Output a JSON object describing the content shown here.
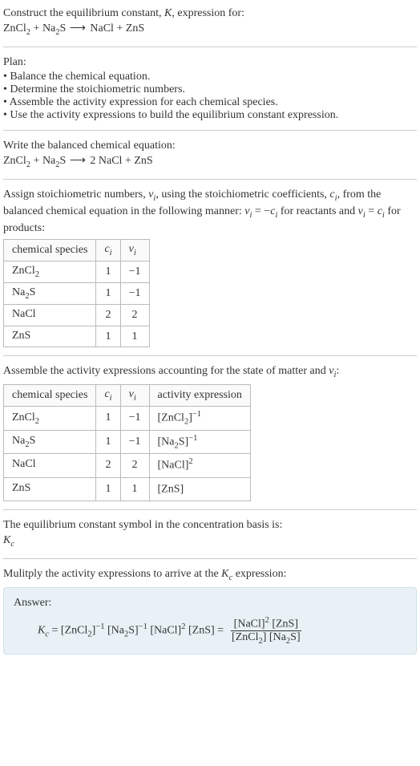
{
  "header": {
    "line1_pre": "Construct the equilibrium constant, ",
    "line1_K": "K",
    "line1_post": ", expression for:",
    "eq_lhs_a": "ZnCl",
    "eq_lhs_a_sub": "2",
    "eq_plus1": " + ",
    "eq_lhs_b": "Na",
    "eq_lhs_b_sub": "2",
    "eq_lhs_b2": "S",
    "eq_arrow": " ⟶ ",
    "eq_rhs_a": "NaCl + ZnS"
  },
  "plan": {
    "title": "Plan:",
    "b1": "Balance the chemical equation.",
    "b2": "Determine the stoichiometric numbers.",
    "b3": "Assemble the activity expression for each chemical species.",
    "b4": "Use the activity expressions to build the equilibrium constant expression."
  },
  "balanced": {
    "intro": "Write the balanced chemical equation:",
    "lhs_a": "ZnCl",
    "lhs_a_sub": "2",
    "plus1": " + ",
    "lhs_b": "Na",
    "lhs_b_sub": "2",
    "lhs_b2": "S",
    "arrow": " ⟶ ",
    "rhs": "2 NaCl + ZnS"
  },
  "stoich": {
    "intro_pre": "Assign stoichiometric numbers, ",
    "nu": "ν",
    "nu_sub": "i",
    "intro_mid1": ", using the stoichiometric coefficients, ",
    "c": "c",
    "c_sub": "i",
    "intro_mid2": ", from the balanced chemical equation in the following manner: ",
    "rel1_lhs": "ν",
    "rel1_lhs_sub": "i",
    "rel1_eq": " = −",
    "rel1_rhs": "c",
    "rel1_rhs_sub": "i",
    "rel_mid": " for reactants and ",
    "rel2_lhs": "ν",
    "rel2_lhs_sub": "i",
    "rel2_eq": " = ",
    "rel2_rhs": "c",
    "rel2_rhs_sub": "i",
    "rel_post": " for products:",
    "h1": "chemical species",
    "h2": "c",
    "h2_sub": "i",
    "h3": "ν",
    "h3_sub": "i",
    "rows": [
      {
        "sp_a": "ZnCl",
        "sp_sub": "2",
        "sp_b": "",
        "c": "1",
        "nu": "−1"
      },
      {
        "sp_a": "Na",
        "sp_sub": "2",
        "sp_b": "S",
        "c": "1",
        "nu": "−1"
      },
      {
        "sp_a": "NaCl",
        "sp_sub": "",
        "sp_b": "",
        "c": "2",
        "nu": "2"
      },
      {
        "sp_a": "ZnS",
        "sp_sub": "",
        "sp_b": "",
        "c": "1",
        "nu": "1"
      }
    ]
  },
  "activity": {
    "intro_pre": "Assemble the activity expressions accounting for the state of matter and ",
    "nu": "ν",
    "nu_sub": "i",
    "intro_post": ":",
    "h1": "chemical species",
    "h2": "c",
    "h2_sub": "i",
    "h3": "ν",
    "h3_sub": "i",
    "h4": "activity expression",
    "rows": [
      {
        "sp_a": "ZnCl",
        "sp_sub": "2",
        "sp_b": "",
        "c": "1",
        "nu": "−1",
        "ae_pre": "[ZnCl",
        "ae_sub": "2",
        "ae_post": "]",
        "ae_sup": "−1"
      },
      {
        "sp_a": "Na",
        "sp_sub": "2",
        "sp_b": "S",
        "c": "1",
        "nu": "−1",
        "ae_pre": "[Na",
        "ae_sub": "2",
        "ae_post": "S]",
        "ae_sup": "−1"
      },
      {
        "sp_a": "NaCl",
        "sp_sub": "",
        "sp_b": "",
        "c": "2",
        "nu": "2",
        "ae_pre": "[NaCl]",
        "ae_sub": "",
        "ae_post": "",
        "ae_sup": "2"
      },
      {
        "sp_a": "ZnS",
        "sp_sub": "",
        "sp_b": "",
        "c": "1",
        "nu": "1",
        "ae_pre": "[ZnS]",
        "ae_sub": "",
        "ae_post": "",
        "ae_sup": ""
      }
    ]
  },
  "basis": {
    "line": "The equilibrium constant symbol in the concentration basis is:",
    "K": "K",
    "K_sub": "c"
  },
  "multiply": {
    "intro_pre": "Mulitply the activity expressions to arrive at the ",
    "K": "K",
    "K_sub": "c",
    "intro_post": " expression:"
  },
  "answer": {
    "label": "Answer:",
    "K": "K",
    "K_sub": "c",
    "eq": " = ",
    "t1_pre": "[ZnCl",
    "t1_sub": "2",
    "t1_post": "]",
    "t1_sup": "−1",
    "t2_pre": " [Na",
    "t2_sub": "2",
    "t2_post": "S]",
    "t2_sup": "−1",
    "t3_pre": " [NaCl]",
    "t3_sup": "2",
    "t4": " [ZnS] = ",
    "num_a": "[NaCl]",
    "num_a_sup": "2",
    "num_b": " [ZnS]",
    "den_a_pre": "[ZnCl",
    "den_a_sub": "2",
    "den_a_post": "]",
    "den_b_pre": " [Na",
    "den_b_sub": "2",
    "den_b_post": "S]"
  }
}
